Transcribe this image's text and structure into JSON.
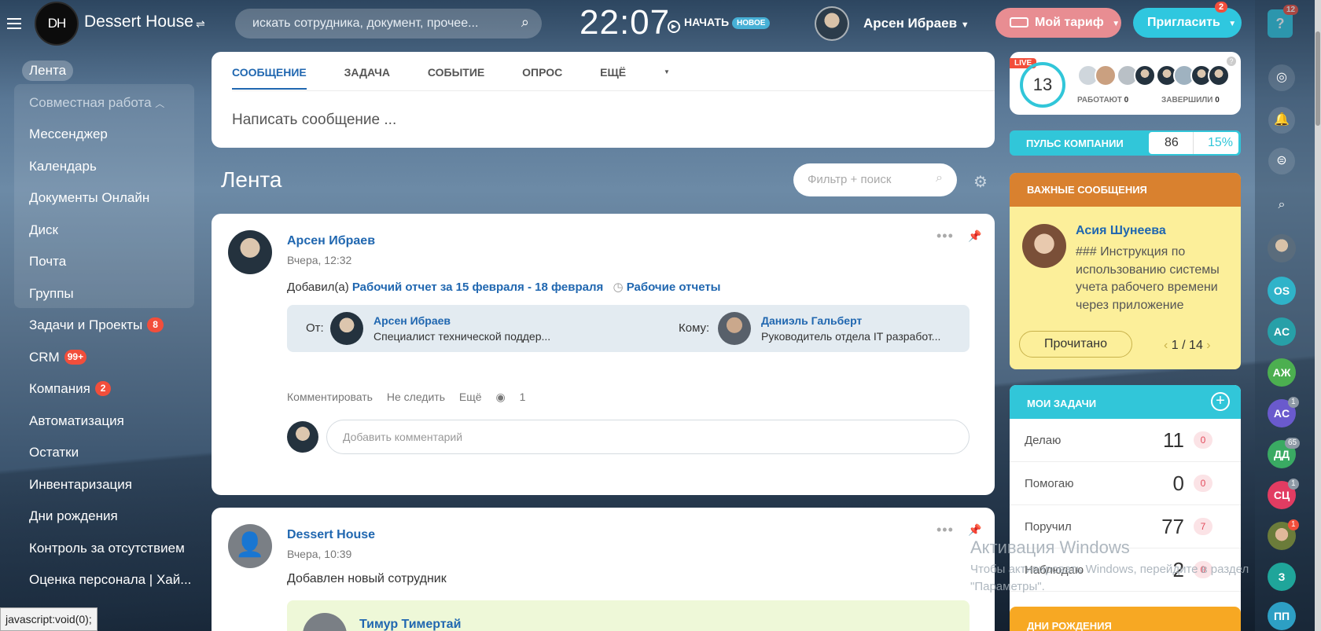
{
  "header": {
    "brand": "Dessert House",
    "logo_text": "DH",
    "search_placeholder": "искать сотрудника, документ, прочее...",
    "clock": "22:07",
    "start_label": "НАЧАТЬ",
    "new_badge": "НОВОЕ",
    "user_name": "Арсен Ибраев",
    "tariff_label": "Мой тариф",
    "invite_label": "Пригласить",
    "invite_count": "2",
    "help_label": "?",
    "help_count": "12"
  },
  "sidebar": {
    "items": [
      {
        "label": "Лента"
      },
      {
        "label": "Совместная работа"
      },
      {
        "label": "Мессенджер"
      },
      {
        "label": "Календарь"
      },
      {
        "label": "Документы Онлайн"
      },
      {
        "label": "Диск"
      },
      {
        "label": "Почта"
      },
      {
        "label": "Группы"
      },
      {
        "label": "Задачи и Проекты",
        "badge": "8"
      },
      {
        "label": "CRM",
        "badge": "99+"
      },
      {
        "label": "Компания",
        "badge": "2"
      },
      {
        "label": "Автоматизация"
      },
      {
        "label": "Остатки"
      },
      {
        "label": "Инвентаризация"
      },
      {
        "label": "Дни рождения"
      },
      {
        "label": "Контроль за отсутствием"
      },
      {
        "label": "Оценка персонала | Хай..."
      }
    ]
  },
  "composer": {
    "tabs": [
      "СООБЩЕНИЕ",
      "ЗАДАЧА",
      "СОБЫТИЕ",
      "ОПРОС",
      "ЕЩЁ"
    ],
    "placeholder": "Написать сообщение ..."
  },
  "feed": {
    "title": "Лента",
    "filter_placeholder": "Фильтр + поиск",
    "post1": {
      "author": "Арсен Ибраев",
      "time": "Вчера, 12:32",
      "added": "Добавил(а)",
      "report_link": "Рабочий отчет за 15 февраля - 18 февраля",
      "category": "Рабочие отчеты",
      "from_label": "От:",
      "from_name": "Арсен Ибраев",
      "from_role": "Специалист технической поддер...",
      "to_label": "Кому:",
      "to_name": "Даниэль Гальберт",
      "to_role": "Руководитель отдела IT разработ...",
      "comment_action": "Комментировать",
      "unfollow_action": "Не следить",
      "more_action": "Ещё",
      "views": "1",
      "comment_placeholder": "Добавить комментарий"
    },
    "post2": {
      "author": "Dessert House",
      "time": "Вчера, 10:39",
      "text": "Добавлен новый сотрудник",
      "employee": "Тимур Тимертай"
    }
  },
  "right": {
    "live_label": "LIVE",
    "live_count": "13",
    "working_label": "РАБОТАЮТ",
    "working_count": "0",
    "finished_label": "ЗАВЕРШИЛИ",
    "finished_count": "0",
    "pulse_label": "ПУЛЬС КОМПАНИИ",
    "pulse_value": "86",
    "pulse_percent": "15%",
    "important_title": "ВАЖНЫЕ СООБЩЕНИЯ",
    "important_author": "Асия Шунеева",
    "important_text": "### Инструкция по использованию системы учета рабочего времени через приложение",
    "read_button": "Прочитано",
    "page_current": "1",
    "page_sep": "/",
    "page_total": "14",
    "tasks_title": "МОИ ЗАДАЧИ",
    "tasks": [
      {
        "label": "Делаю",
        "count": "11",
        "badge": "0"
      },
      {
        "label": "Помогаю",
        "count": "0",
        "badge": "0"
      },
      {
        "label": "Поручил",
        "count": "77",
        "badge": "7"
      },
      {
        "label": "Наблюдаю",
        "count": "2",
        "badge": "0"
      }
    ],
    "birthdays_title": "ДНИ РОЖДЕНИЯ"
  },
  "rightbar": {
    "avatars": [
      {
        "initials": "OS",
        "color": "#2fb3c9"
      },
      {
        "initials": "AC",
        "color": "#27a0a8"
      },
      {
        "initials": "АЖ",
        "color": "#4caf50"
      },
      {
        "initials": "AC",
        "color": "#6a5acd",
        "badge": "1"
      },
      {
        "initials": "ДД",
        "color": "#3aaa63",
        "badge": "65"
      },
      {
        "initials": "СЦ",
        "color": "#e23c62",
        "badge": "1"
      },
      {
        "initials": "З",
        "color": "#1fa59a"
      },
      {
        "initials": "ПП",
        "color": "#2d9fc4"
      }
    ]
  },
  "watermark": {
    "title": "Активация Windows",
    "text": "Чтобы активировать Windows, перейдите в раздел \"Параметры\"."
  },
  "statusbar": {
    "text": "javascript:void(0);"
  },
  "colors": {
    "accent": "#31c6d9",
    "link": "#2067b0",
    "badge": "#f24e3b",
    "important": "#d9812f"
  }
}
